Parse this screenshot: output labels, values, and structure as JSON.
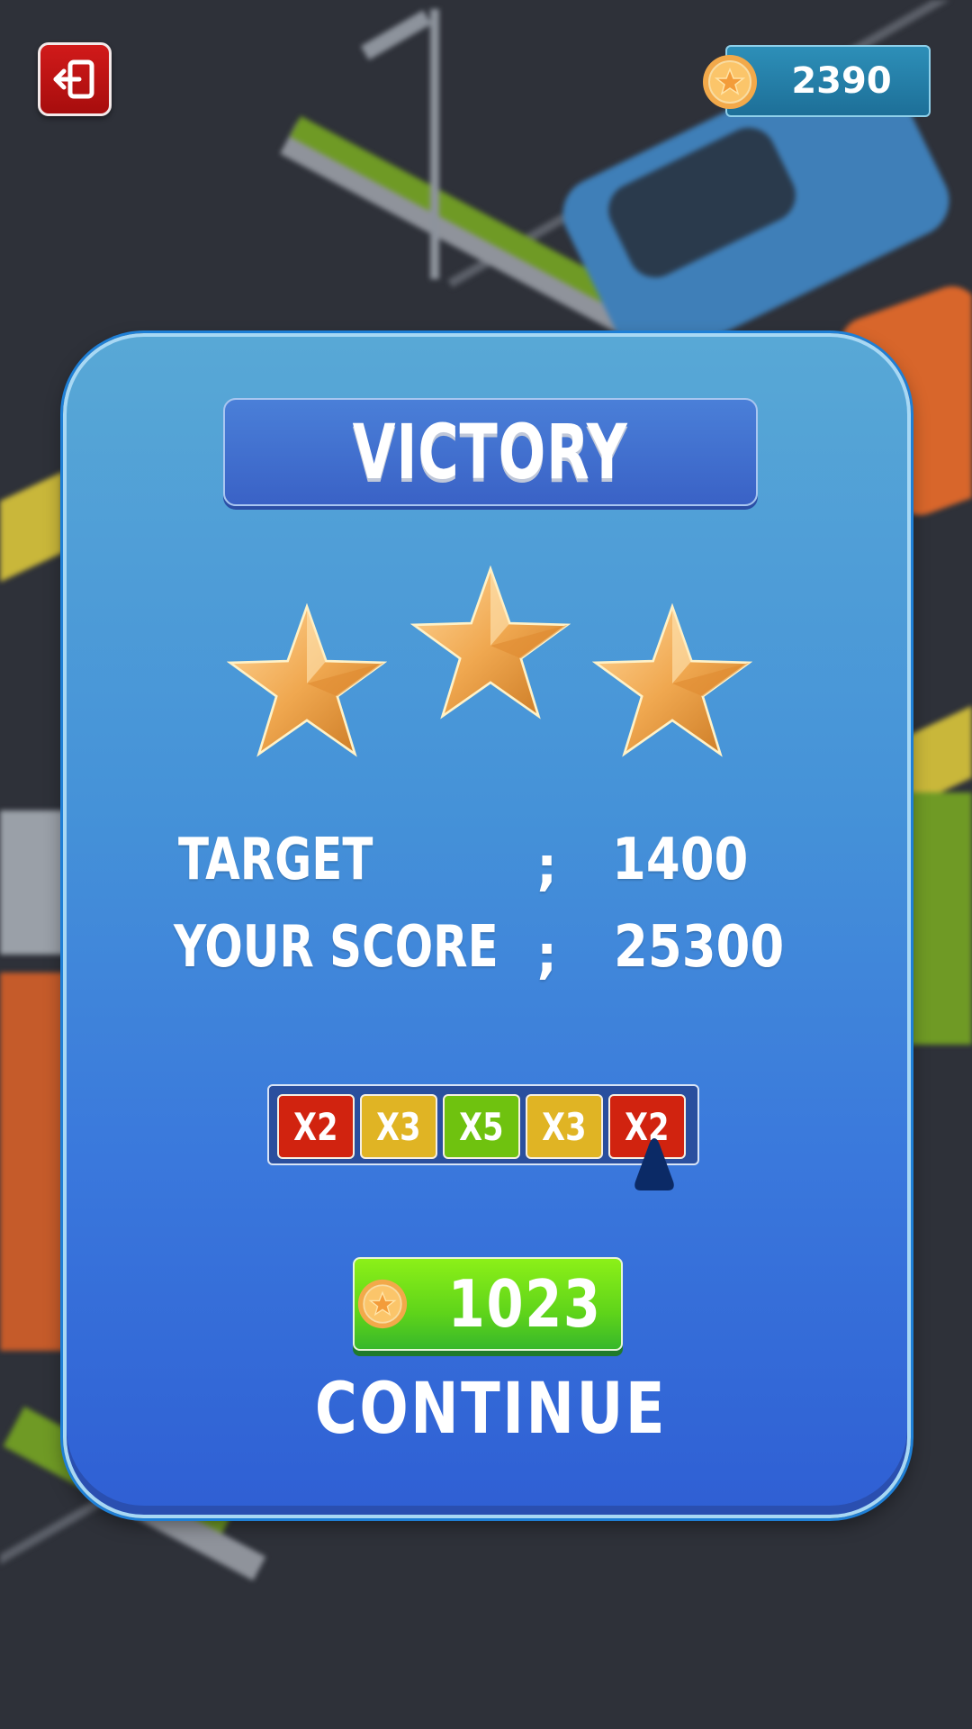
{
  "hud": {
    "coins": "2390",
    "exit_icon": "exit-door-icon",
    "coin_icon": "coin-star-icon"
  },
  "panel": {
    "title": "VICTORY",
    "stars_earned": 3,
    "stars_total": 3,
    "stats": [
      {
        "label": "TARGET",
        "separator": ";",
        "value": "1400"
      },
      {
        "label": "YOUR SCORE",
        "separator": ";",
        "value": "25300"
      }
    ],
    "multipliers": [
      {
        "label": "X2",
        "color": "#d1230f"
      },
      {
        "label": "X3",
        "color": "#e0b424"
      },
      {
        "label": "X5",
        "color": "#6fc20f"
      },
      {
        "label": "X3",
        "color": "#e0b424"
      },
      {
        "label": "X2",
        "color": "#d1230f"
      }
    ],
    "selected_multiplier_index": 4,
    "reward_amount": "1023",
    "continue_label": "CONTINUE"
  },
  "colors": {
    "panel_top": "#58a8d6",
    "panel_bottom": "#2f5fd4",
    "exit_button": "#c41414",
    "reward_button": "#5fd41a"
  }
}
